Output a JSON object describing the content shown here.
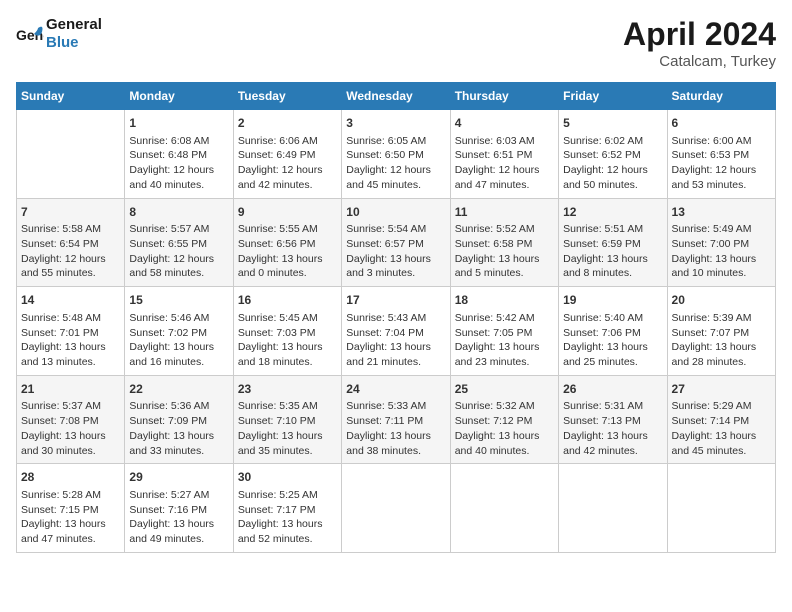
{
  "header": {
    "logo_line1": "General",
    "logo_line2": "Blue",
    "main_title": "April 2024",
    "subtitle": "Catalcam, Turkey"
  },
  "days_of_week": [
    "Sunday",
    "Monday",
    "Tuesday",
    "Wednesday",
    "Thursday",
    "Friday",
    "Saturday"
  ],
  "weeks": [
    [
      {
        "day": "",
        "content": ""
      },
      {
        "day": "1",
        "content": "Sunrise: 6:08 AM\nSunset: 6:48 PM\nDaylight: 12 hours\nand 40 minutes."
      },
      {
        "day": "2",
        "content": "Sunrise: 6:06 AM\nSunset: 6:49 PM\nDaylight: 12 hours\nand 42 minutes."
      },
      {
        "day": "3",
        "content": "Sunrise: 6:05 AM\nSunset: 6:50 PM\nDaylight: 12 hours\nand 45 minutes."
      },
      {
        "day": "4",
        "content": "Sunrise: 6:03 AM\nSunset: 6:51 PM\nDaylight: 12 hours\nand 47 minutes."
      },
      {
        "day": "5",
        "content": "Sunrise: 6:02 AM\nSunset: 6:52 PM\nDaylight: 12 hours\nand 50 minutes."
      },
      {
        "day": "6",
        "content": "Sunrise: 6:00 AM\nSunset: 6:53 PM\nDaylight: 12 hours\nand 53 minutes."
      }
    ],
    [
      {
        "day": "7",
        "content": "Sunrise: 5:58 AM\nSunset: 6:54 PM\nDaylight: 12 hours\nand 55 minutes."
      },
      {
        "day": "8",
        "content": "Sunrise: 5:57 AM\nSunset: 6:55 PM\nDaylight: 12 hours\nand 58 minutes."
      },
      {
        "day": "9",
        "content": "Sunrise: 5:55 AM\nSunset: 6:56 PM\nDaylight: 13 hours\nand 0 minutes."
      },
      {
        "day": "10",
        "content": "Sunrise: 5:54 AM\nSunset: 6:57 PM\nDaylight: 13 hours\nand 3 minutes."
      },
      {
        "day": "11",
        "content": "Sunrise: 5:52 AM\nSunset: 6:58 PM\nDaylight: 13 hours\nand 5 minutes."
      },
      {
        "day": "12",
        "content": "Sunrise: 5:51 AM\nSunset: 6:59 PM\nDaylight: 13 hours\nand 8 minutes."
      },
      {
        "day": "13",
        "content": "Sunrise: 5:49 AM\nSunset: 7:00 PM\nDaylight: 13 hours\nand 10 minutes."
      }
    ],
    [
      {
        "day": "14",
        "content": "Sunrise: 5:48 AM\nSunset: 7:01 PM\nDaylight: 13 hours\nand 13 minutes."
      },
      {
        "day": "15",
        "content": "Sunrise: 5:46 AM\nSunset: 7:02 PM\nDaylight: 13 hours\nand 16 minutes."
      },
      {
        "day": "16",
        "content": "Sunrise: 5:45 AM\nSunset: 7:03 PM\nDaylight: 13 hours\nand 18 minutes."
      },
      {
        "day": "17",
        "content": "Sunrise: 5:43 AM\nSunset: 7:04 PM\nDaylight: 13 hours\nand 21 minutes."
      },
      {
        "day": "18",
        "content": "Sunrise: 5:42 AM\nSunset: 7:05 PM\nDaylight: 13 hours\nand 23 minutes."
      },
      {
        "day": "19",
        "content": "Sunrise: 5:40 AM\nSunset: 7:06 PM\nDaylight: 13 hours\nand 25 minutes."
      },
      {
        "day": "20",
        "content": "Sunrise: 5:39 AM\nSunset: 7:07 PM\nDaylight: 13 hours\nand 28 minutes."
      }
    ],
    [
      {
        "day": "21",
        "content": "Sunrise: 5:37 AM\nSunset: 7:08 PM\nDaylight: 13 hours\nand 30 minutes."
      },
      {
        "day": "22",
        "content": "Sunrise: 5:36 AM\nSunset: 7:09 PM\nDaylight: 13 hours\nand 33 minutes."
      },
      {
        "day": "23",
        "content": "Sunrise: 5:35 AM\nSunset: 7:10 PM\nDaylight: 13 hours\nand 35 minutes."
      },
      {
        "day": "24",
        "content": "Sunrise: 5:33 AM\nSunset: 7:11 PM\nDaylight: 13 hours\nand 38 minutes."
      },
      {
        "day": "25",
        "content": "Sunrise: 5:32 AM\nSunset: 7:12 PM\nDaylight: 13 hours\nand 40 minutes."
      },
      {
        "day": "26",
        "content": "Sunrise: 5:31 AM\nSunset: 7:13 PM\nDaylight: 13 hours\nand 42 minutes."
      },
      {
        "day": "27",
        "content": "Sunrise: 5:29 AM\nSunset: 7:14 PM\nDaylight: 13 hours\nand 45 minutes."
      }
    ],
    [
      {
        "day": "28",
        "content": "Sunrise: 5:28 AM\nSunset: 7:15 PM\nDaylight: 13 hours\nand 47 minutes."
      },
      {
        "day": "29",
        "content": "Sunrise: 5:27 AM\nSunset: 7:16 PM\nDaylight: 13 hours\nand 49 minutes."
      },
      {
        "day": "30",
        "content": "Sunrise: 5:25 AM\nSunset: 7:17 PM\nDaylight: 13 hours\nand 52 minutes."
      },
      {
        "day": "",
        "content": ""
      },
      {
        "day": "",
        "content": ""
      },
      {
        "day": "",
        "content": ""
      },
      {
        "day": "",
        "content": ""
      }
    ]
  ]
}
